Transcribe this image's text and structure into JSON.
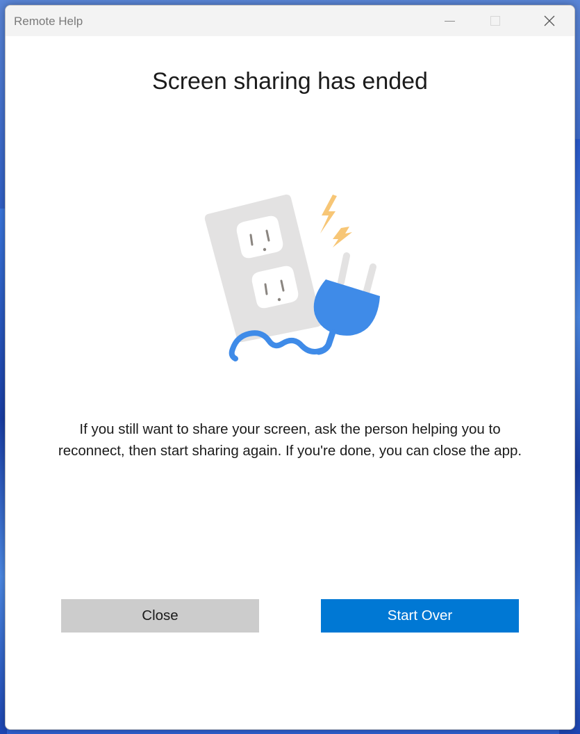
{
  "window": {
    "title": "Remote Help"
  },
  "main": {
    "heading": "Screen sharing has ended",
    "message_line1": "If you still want to share your screen, ask the person helping you to",
    "message_line2": "reconnect, then start sharing again. If you're done, you can close the app.",
    "illustration_icon": "unplugged-outlet-illustration"
  },
  "actions": {
    "close_label": "Close",
    "start_over_label": "Start Over"
  },
  "colors": {
    "primary_button": "#0078d4",
    "secondary_button": "#cccccc",
    "plug": "#3f8be8",
    "spark": "#f7c676",
    "outlet": "#e3e2e2"
  }
}
